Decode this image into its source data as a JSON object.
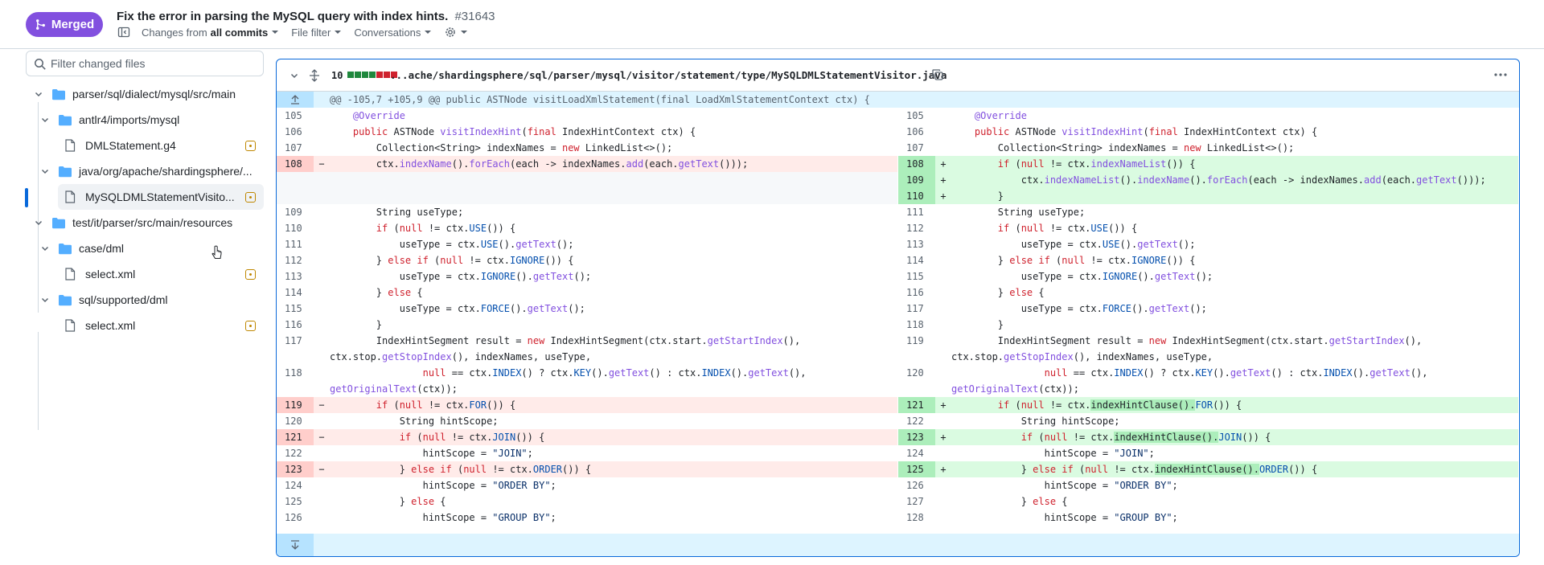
{
  "header": {
    "badge_label": "Merged",
    "title": "Fix the error in parsing the MySQL query with index hints.",
    "number": "#31643",
    "changes_from_prefix": "Changes from",
    "changes_from_value": "all commits",
    "file_filter_label": "File filter",
    "conversations_label": "Conversations"
  },
  "sidebar": {
    "filter_placeholder": "Filter changed files",
    "items": [
      {
        "label": "parser/sql/dialect/mysql/src/main",
        "type": "folder"
      },
      {
        "label": "antlr4/imports/mysql",
        "type": "folder"
      },
      {
        "label": "DMLStatement.g4",
        "type": "file"
      },
      {
        "label": "java/org/apache/shardingsphere/...",
        "type": "folder"
      },
      {
        "label": "MySQLDMLStatementVisito...",
        "type": "file"
      },
      {
        "label": "test/it/parser/src/main/resources",
        "type": "folder"
      },
      {
        "label": "case/dml",
        "type": "folder"
      },
      {
        "label": "select.xml",
        "type": "file"
      },
      {
        "label": "sql/supported/dml",
        "type": "folder"
      },
      {
        "label": "select.xml",
        "type": "file"
      }
    ]
  },
  "diff": {
    "changed_count": "10",
    "diffstat": [
      "add",
      "add",
      "add",
      "add",
      "del",
      "del",
      "del"
    ],
    "file_path": "...ache/shardingsphere/sql/parser/mysql/visitor/statement/type/MySQLDMLStatementVisitor.java",
    "hunk_header": "@@ -105,7 +105,9 @@ public ASTNode visitLoadXmlStatement(final LoadXmlStatementContext ctx) {",
    "left_nums": [
      "105",
      "106",
      "107",
      "108",
      "",
      "",
      "109",
      "110",
      "111",
      "112",
      "113",
      "114",
      "115",
      "116",
      "117",
      "118",
      "119",
      "120",
      "121",
      "122",
      "123",
      "124",
      "125",
      "126"
    ],
    "right_nums": [
      "105",
      "106",
      "107",
      "108",
      "109",
      "110",
      "111",
      "112",
      "113",
      "114",
      "115",
      "116",
      "117",
      "118",
      "119",
      "120",
      "121",
      "122",
      "123",
      "124",
      "125",
      "126",
      "127",
      "128"
    ]
  },
  "colors": {
    "merged": "#8250df",
    "accent": "#0969da",
    "add_bg": "#dafbe1",
    "del_bg": "#ffebe9",
    "hunk_bg": "#ddf4ff",
    "modified": "#bf8700"
  }
}
